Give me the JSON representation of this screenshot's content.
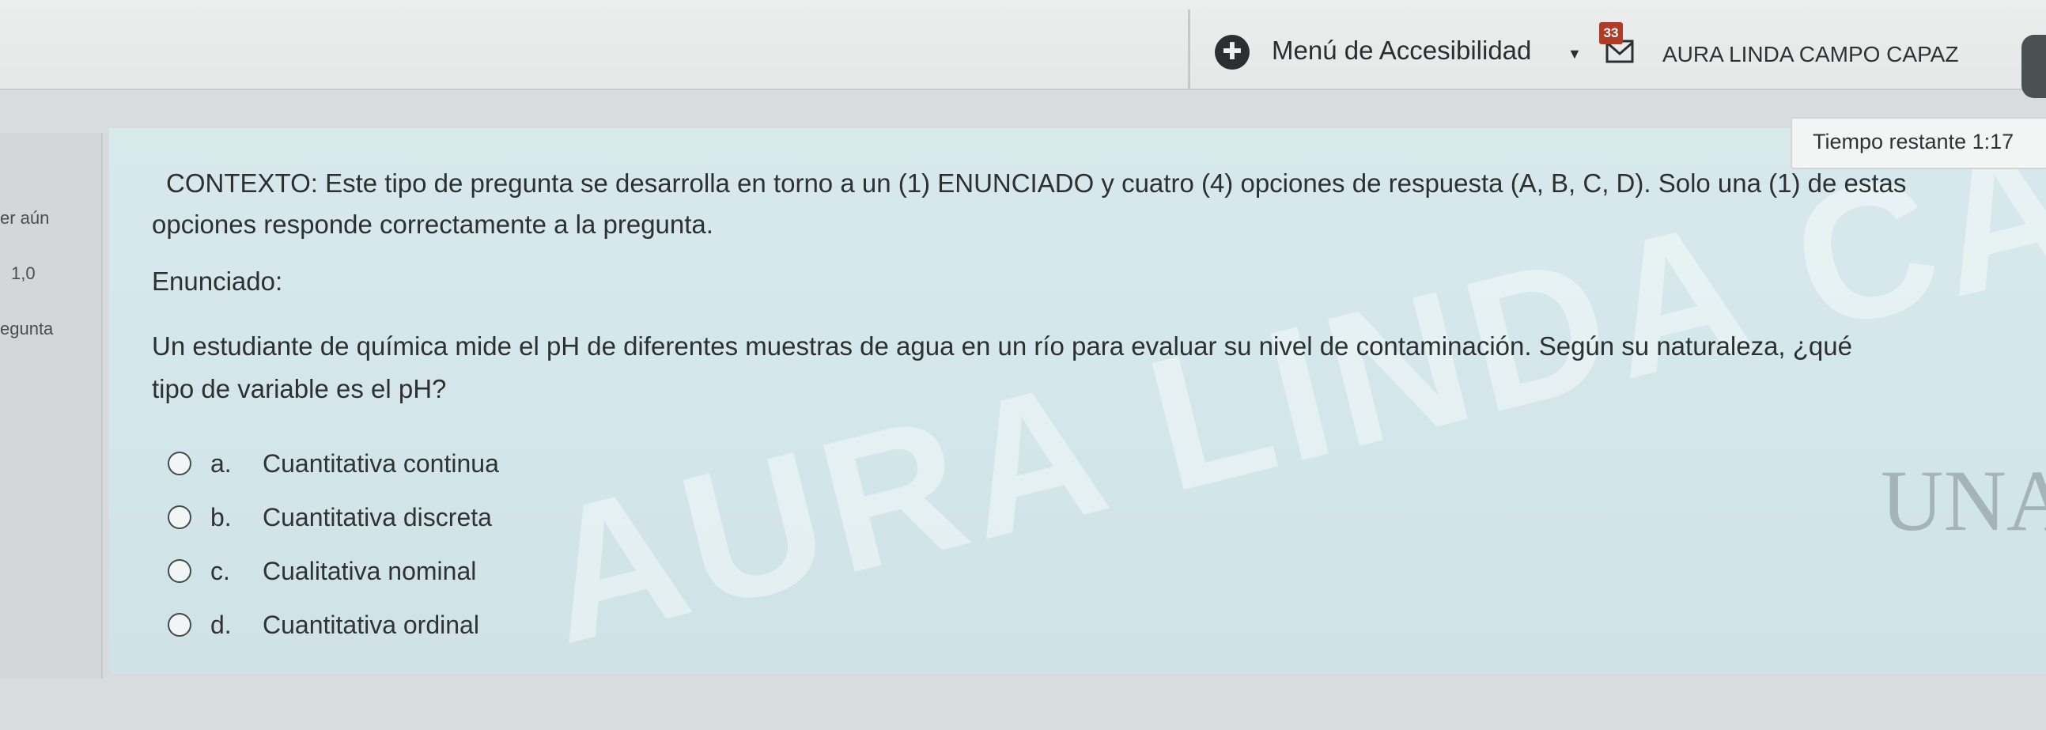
{
  "header": {
    "accessibility_menu_label": "Menú de Accesibilidad",
    "notification_count": "33",
    "user_name": "AURA LINDA CAMPO CAPAZ",
    "icons": [
      "accessibility-icon",
      "chevron-down-icon",
      "notification-icon",
      "avatar"
    ]
  },
  "left_panel": {
    "status_text": "er aún",
    "grade_text": "1,0",
    "question_label": "egunta"
  },
  "timer": {
    "label": "Tiempo restante 1:17"
  },
  "question": {
    "context_line1": "CONTEXTO: Este tipo de pregunta se desarrolla en torno a un (1) ENUNCIADO y cuatro (4) opciones de respuesta (A, B, C, D). Solo una (1) de estas",
    "context_line2": "opciones responde correctamente a la pregunta.",
    "statement_label": "Enunciado:",
    "statement_line1": "Un estudiante de química mide el pH de diferentes muestras de agua en un río para evaluar su nivel de contaminación. Según su naturaleza, ¿qué",
    "statement_line2": "tipo de variable es el pH?",
    "options": [
      {
        "letter": "a.",
        "text": "Cuantitativa continua"
      },
      {
        "letter": "b.",
        "text": "Cuantitativa discreta"
      },
      {
        "letter": "c.",
        "text": "Cualitativa nominal"
      },
      {
        "letter": "d.",
        "text": "Cuantitativa ordinal"
      }
    ]
  },
  "watermark": {
    "text": "AURA LINDA CAMPO CAPAZ"
  },
  "logo": {
    "text": "UNAD"
  }
}
